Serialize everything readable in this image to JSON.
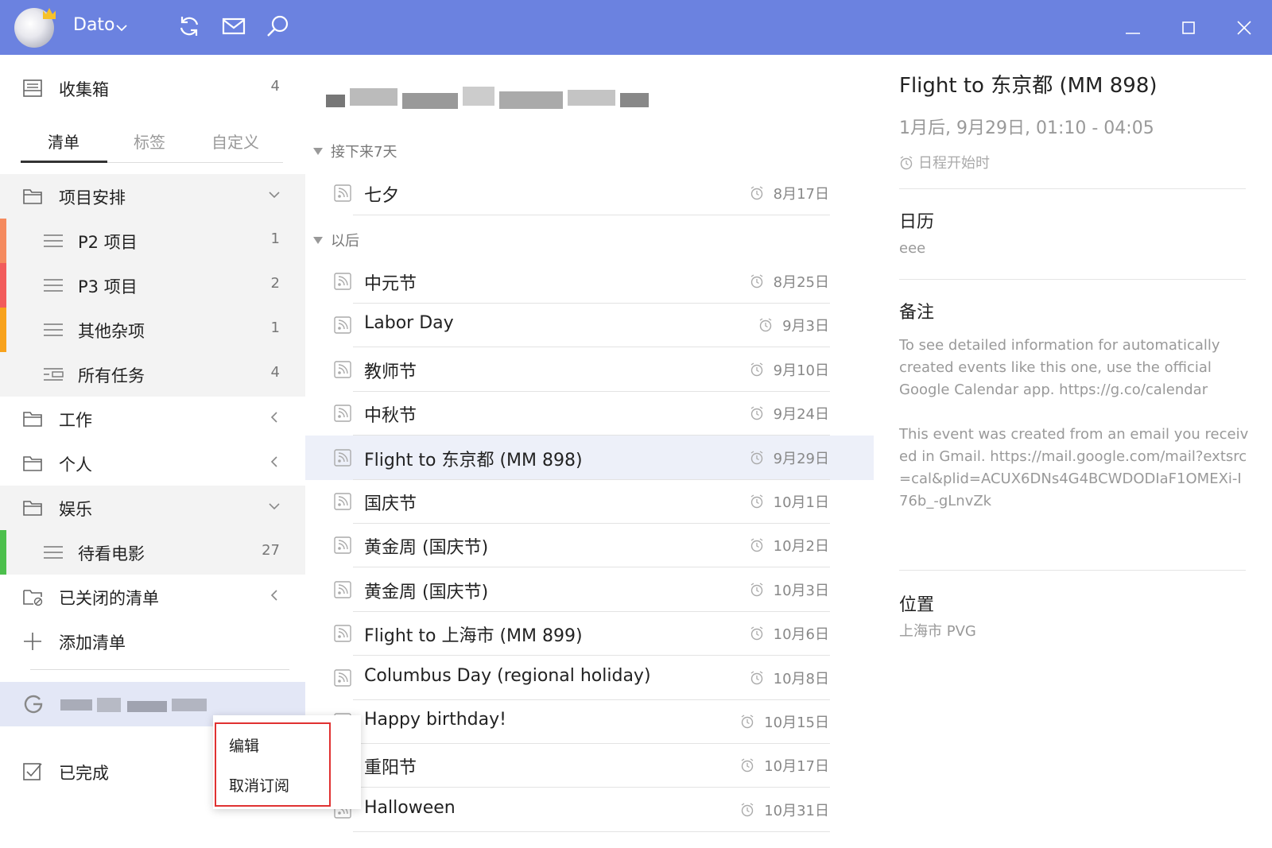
{
  "titlebar": {
    "username": "Dato",
    "caret": "⌵",
    "color": "#6b82e0"
  },
  "sidebar": {
    "inbox": {
      "label": "收集箱",
      "count": "4"
    },
    "tabs": [
      "清单",
      "标签",
      "自定义"
    ],
    "groups": [
      {
        "label": "项目安排",
        "expanded": true
      },
      {
        "label": "工作",
        "expanded": false
      },
      {
        "label": "个人",
        "expanded": false
      },
      {
        "label": "娱乐",
        "expanded": true
      }
    ],
    "lists": [
      {
        "label": "P2 项目",
        "count": "1",
        "color": "#f58a5e"
      },
      {
        "label": "P3 项目",
        "count": "2",
        "color": "#f25b5b"
      },
      {
        "label": "其他杂项",
        "count": "1",
        "color": "#f8a21c"
      },
      {
        "label": "所有任务",
        "count": "4"
      },
      {
        "label": "待看电影",
        "count": "27",
        "color": "#4cbf4c"
      }
    ],
    "closed_lists": "已关闭的清单",
    "add_list": "添加清单",
    "completed": "已完成"
  },
  "list": {
    "sections": [
      "接下来7天",
      "以后"
    ],
    "next7": [
      {
        "title": "七夕",
        "date": "8月17日"
      }
    ],
    "later": [
      {
        "title": "中元节",
        "date": "8月25日"
      },
      {
        "title": "Labor Day",
        "date": "9月3日"
      },
      {
        "title": "教师节",
        "date": "9月10日"
      },
      {
        "title": "中秋节",
        "date": "9月24日"
      },
      {
        "title": "Flight to 东京都 (MM 898)",
        "date": "9月29日",
        "selected": true
      },
      {
        "title": "国庆节",
        "date": "10月1日"
      },
      {
        "title": "黄金周 (国庆节)",
        "date": "10月2日"
      },
      {
        "title": "黄金周 (国庆节)",
        "date": "10月3日"
      },
      {
        "title": "Flight to 上海市 (MM 899)",
        "date": "10月6日"
      },
      {
        "title": "Columbus Day (regional holiday)",
        "date": "10月8日"
      },
      {
        "title": "Happy birthday!",
        "date": "10月15日"
      },
      {
        "title": "重阳节",
        "date": "10月17日"
      },
      {
        "title": "Halloween",
        "date": "10月31日"
      }
    ]
  },
  "detail": {
    "title": "Flight to 东京都 (MM 898)",
    "time": "1月后, 9月29日, 01:10 - 04:05",
    "reminder": "日程开始时",
    "calendar_head": "日历",
    "calendar_val": "eee",
    "notes_head": "备注",
    "notes_p1": "To see detailed information for automatically created events like this one, use the official Google Calendar app. https://g.co/calendar",
    "notes_p2": "This event was created from an email you received in Gmail. https://mail.google.com/mail?extsrc=cal&plid=ACUX6DNs4G4BCWDODIaF1OMEXi-I76b_-gLnvZk",
    "location_head": "位置",
    "location_val": "上海市 PVG"
  },
  "context_menu": {
    "items": [
      "编辑",
      "取消订阅"
    ],
    "highlight_color": "#e03131"
  }
}
